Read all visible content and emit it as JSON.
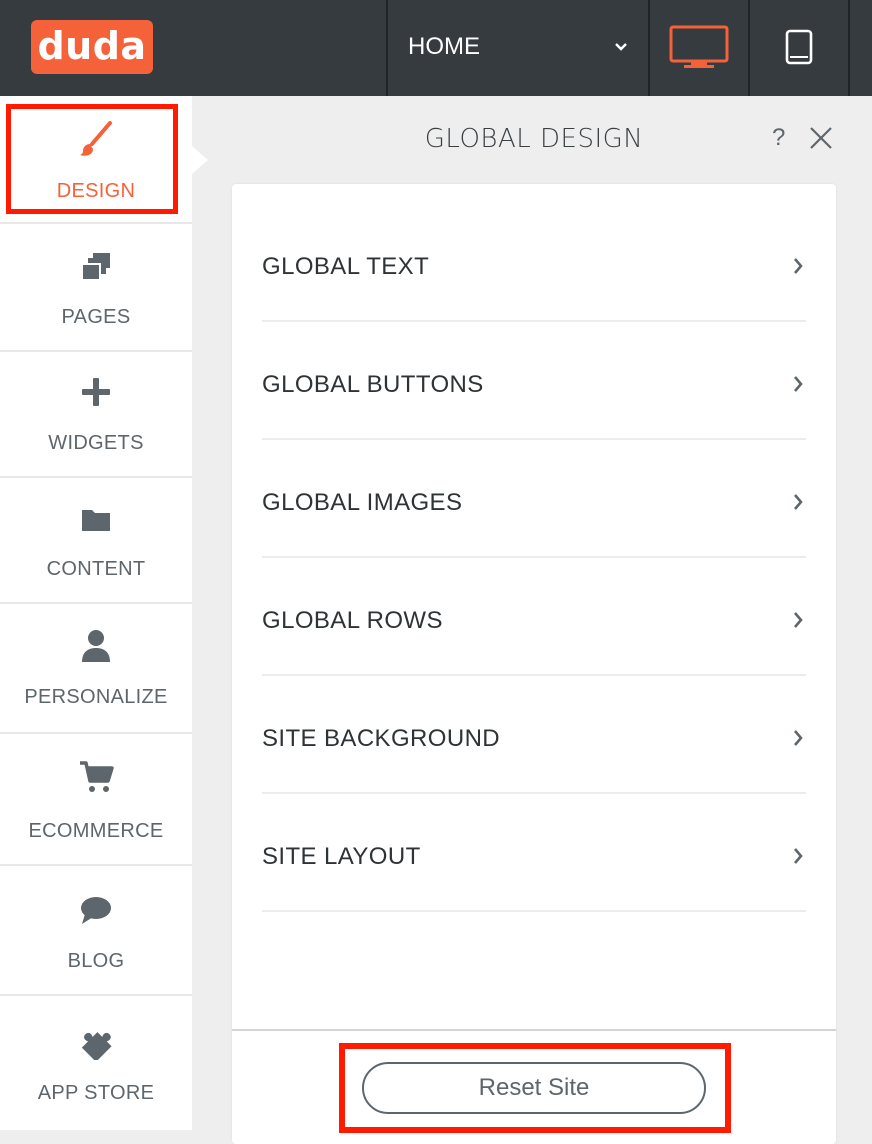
{
  "app": {
    "logo_text": "duda",
    "brand_color": "#f5623a",
    "highlight_color": "#ff1a00"
  },
  "topbar": {
    "page_selector": {
      "value": "HOME",
      "icon": "chevron-down-icon"
    },
    "devices": [
      {
        "name": "desktop",
        "icon": "desktop-icon",
        "active": true
      },
      {
        "name": "tablet",
        "icon": "tablet-icon",
        "active": false
      }
    ]
  },
  "sidebar": {
    "items": [
      {
        "label": "DESIGN",
        "icon": "paintbrush-icon",
        "active": true
      },
      {
        "label": "PAGES",
        "icon": "pages-icon"
      },
      {
        "label": "WIDGETS",
        "icon": "plus-icon"
      },
      {
        "label": "CONTENT",
        "icon": "folder-icon"
      },
      {
        "label": "PERSONALIZE",
        "icon": "person-icon"
      },
      {
        "label": "ECOMMERCE",
        "icon": "cart-icon"
      },
      {
        "label": "BLOG",
        "icon": "speech-bubble-icon"
      },
      {
        "label": "APP STORE",
        "icon": "puzzle-icon"
      }
    ]
  },
  "panel": {
    "title": "GLOBAL DESIGN",
    "help_label": "?",
    "menu": [
      {
        "label": "GLOBAL TEXT"
      },
      {
        "label": "GLOBAL BUTTONS"
      },
      {
        "label": "GLOBAL IMAGES"
      },
      {
        "label": "GLOBAL ROWS"
      },
      {
        "label": "SITE BACKGROUND"
      },
      {
        "label": "SITE LAYOUT"
      }
    ],
    "reset_label": "Reset Site"
  }
}
